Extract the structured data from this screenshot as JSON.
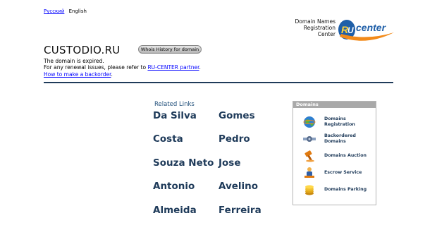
{
  "lang": {
    "ru": "Русский",
    "en": "English"
  },
  "rucenter": {
    "text": "Domain Names\nRegistration\nCenter",
    "logo_r": "R",
    "logo_u": "U",
    "logo_word": "center"
  },
  "domain": "CUSTODIO.RU",
  "whois_button": "Whois History for domain",
  "message": {
    "line1": "The domain is expired.",
    "line2_prefix": "For any renewal issues, please refer to ",
    "line2_link": "RU-CENTER partner",
    "line2_suffix": ".",
    "backorder_link": "How to make a backorder",
    "backorder_suffix": "."
  },
  "related": {
    "title": "Related Links",
    "items": [
      "Da Silva",
      "Gomes",
      "Costa",
      "Pedro",
      "Souza Neto",
      "Jose",
      "Antonio",
      "Avelino",
      "Almeida",
      "Ferreira"
    ]
  },
  "panel": {
    "title": "Domains",
    "items": [
      {
        "label": "Domains\nRegistration",
        "icon": "globe-icon"
      },
      {
        "label": "Backordered\nDomains",
        "icon": "satellite-icon"
      },
      {
        "label": "Domains Auction",
        "icon": "auction-hammer-icon"
      },
      {
        "label": "Escrow Service",
        "icon": "escrow-icon"
      },
      {
        "label": "Domains Parking",
        "icon": "parking-coins-icon"
      }
    ]
  },
  "colors": {
    "link": "#0000ff",
    "related": "#1f3b5a",
    "divider": "#1f3b5a",
    "logo_blue": "#1f5fa8",
    "logo_orange": "#f28a1a"
  }
}
